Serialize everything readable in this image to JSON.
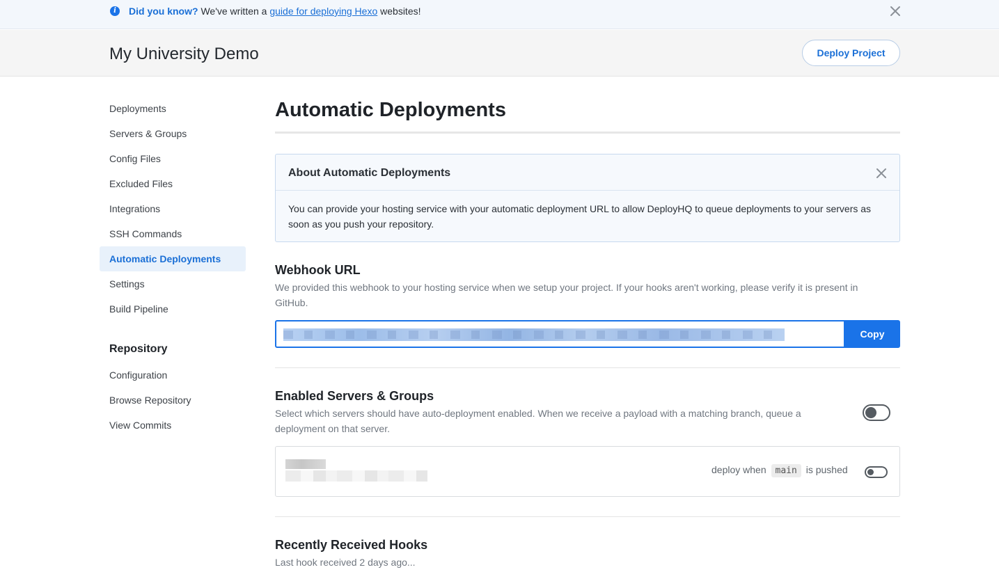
{
  "notice": {
    "lead": "Did you know?",
    "text_before": " We've written a ",
    "link": "guide for deploying Hexo",
    "text_after": " websites!"
  },
  "header": {
    "project_title": "My University Demo",
    "deploy_button": "Deploy Project"
  },
  "sidebar": {
    "items": [
      {
        "label": "Deployments",
        "active": false
      },
      {
        "label": "Servers & Groups",
        "active": false
      },
      {
        "label": "Config Files",
        "active": false
      },
      {
        "label": "Excluded Files",
        "active": false
      },
      {
        "label": "Integrations",
        "active": false
      },
      {
        "label": "SSH Commands",
        "active": false
      },
      {
        "label": "Automatic Deployments",
        "active": true
      },
      {
        "label": "Settings",
        "active": false
      },
      {
        "label": "Build Pipeline",
        "active": false
      }
    ],
    "repository_heading": "Repository",
    "repository_items": [
      {
        "label": "Configuration"
      },
      {
        "label": "Browse Repository"
      },
      {
        "label": "View Commits"
      }
    ]
  },
  "main": {
    "page_title": "Automatic Deployments",
    "about": {
      "title": "About Automatic Deployments",
      "body": "You can provide your hosting service with your automatic deployment URL to allow DeployHQ to queue deployments to your servers as soon as you push your repository."
    },
    "webhook": {
      "title": "Webhook URL",
      "description": "We provided this webhook to your hosting service when we setup your project. If your hooks aren't working, please verify it is present in GitHub.",
      "copy_button": "Copy"
    },
    "enabled_servers": {
      "title": "Enabled Servers & Groups",
      "description": "Select which servers should have auto-deployment enabled. When we receive a payload with a matching branch, queue a deployment on that server.",
      "master_toggle_on": false,
      "server": {
        "deploy_when_prefix": "deploy when",
        "branch": "main",
        "deploy_when_suffix": "is pushed",
        "toggle_on": false
      }
    },
    "hooks": {
      "title": "Recently Received Hooks",
      "description": "Last hook received 2 days ago..."
    }
  },
  "colors": {
    "accent": "#1a73e8",
    "link": "#1a6fd6",
    "active_bg": "#e8f1fb"
  }
}
